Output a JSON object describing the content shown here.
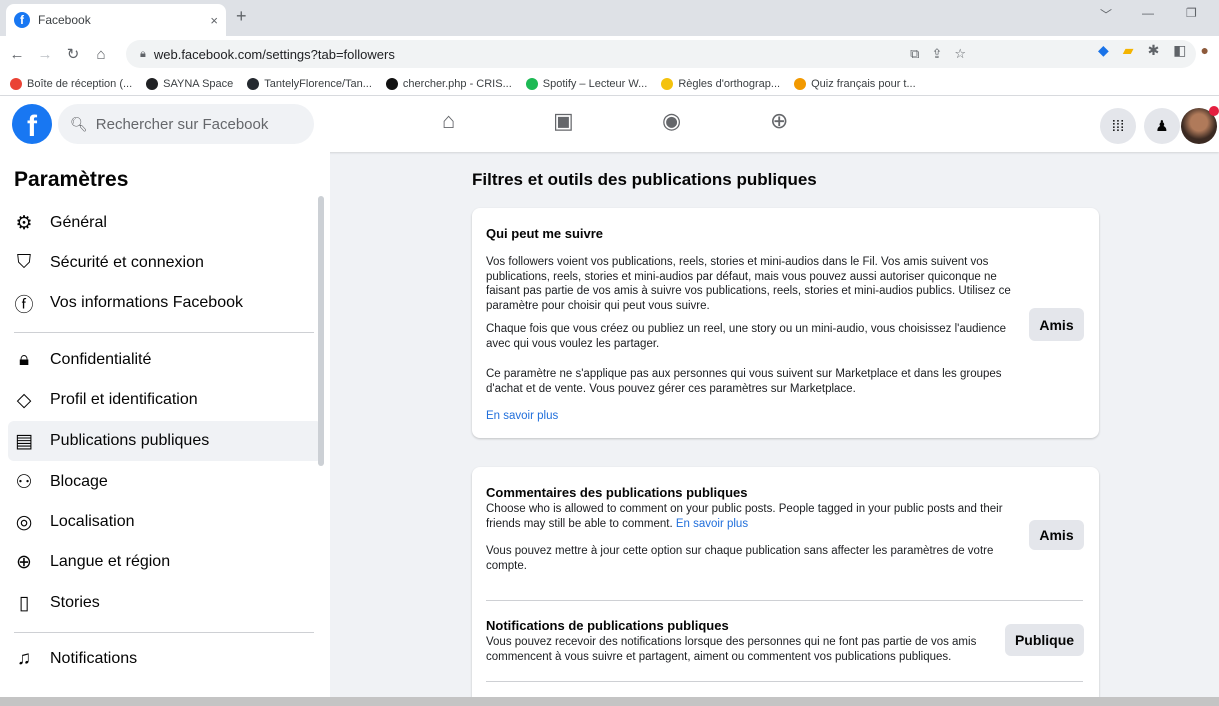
{
  "browser": {
    "tab_title": "Facebook",
    "tab_close": "×",
    "new_tab": "+",
    "url": "web.facebook.com/settings?tab=followers",
    "bookmarks": [
      {
        "label": "Boîte de réception (...",
        "color": "#ea4335"
      },
      {
        "label": "SAYNA Space",
        "color": "#202124"
      },
      {
        "label": "TantelyFlorence/Tan...",
        "color": "#24292f"
      },
      {
        "label": "chercher.php - CRIS...",
        "color": "#111111"
      },
      {
        "label": "Spotify – Lecteur W...",
        "color": "#1db954"
      },
      {
        "label": "Règles d'orthograp...",
        "color": "#f4c20d"
      },
      {
        "label": "Quiz français pour t...",
        "color": "#f29900"
      }
    ]
  },
  "header": {
    "logo": "f",
    "search_placeholder": "Rechercher sur Facebook"
  },
  "sidebar": {
    "title": "Paramètres",
    "items": [
      {
        "label": "Général",
        "icon": "gear-icon",
        "glyph": "⚙"
      },
      {
        "label": "Sécurité et connexion",
        "icon": "shield-icon",
        "glyph": "⛉"
      },
      {
        "label": "Vos informations Facebook",
        "icon": "facebook-icon",
        "glyph": "ⓕ"
      },
      {
        "label": "Confidentialité",
        "icon": "lock-icon",
        "glyph": "🔒︎"
      },
      {
        "label": "Profil et identification",
        "icon": "tag-icon",
        "glyph": "◇"
      },
      {
        "label": "Publications publiques",
        "icon": "public-posts-icon",
        "glyph": "▤"
      },
      {
        "label": "Blocage",
        "icon": "block-icon",
        "glyph": "⚇"
      },
      {
        "label": "Localisation",
        "icon": "location-icon",
        "glyph": "◎"
      },
      {
        "label": "Langue et région",
        "icon": "globe-icon",
        "glyph": "⊕"
      },
      {
        "label": "Stories",
        "icon": "book-icon",
        "glyph": "▯"
      },
      {
        "label": "Notifications",
        "icon": "bell-icon",
        "glyph": "♫"
      }
    ]
  },
  "main": {
    "title": "Filtres et outils des publications publiques",
    "follow": {
      "title": "Qui peut me suivre",
      "p1": "Vos followers voient vos publications, reels, stories et mini-audios dans le Fil. Vos amis suivent vos publications, reels, stories et mini-audios par défaut, mais vous pouvez aussi autoriser quiconque ne faisant pas partie de vos amis à suivre vos publications, reels, stories et mini-audios publics. Utilisez ce paramètre pour choisir qui peut vous suivre.",
      "p2": "Chaque fois que vous créez ou publiez un reel, une story ou un mini-audio, vous choisissez l'audience avec qui vous voulez les partager.",
      "p3": "Ce paramètre ne s'applique pas aux personnes qui vous suivent sur Marketplace et dans les groupes d'achat et de vente. Vous pouvez gérer ces paramètres sur Marketplace.",
      "link": "En savoir plus",
      "button": "Amis"
    },
    "comments": {
      "title": "Commentaires des publications publiques",
      "p1": "Choose who is allowed to comment on your public posts. People tagged in your public posts and their friends may still be able to comment.",
      "link": "En savoir plus",
      "p2": "Vous pouvez mettre à jour cette option sur chaque publication sans affecter les paramètres de votre compte.",
      "button": "Amis"
    },
    "notifications": {
      "title": "Notifications de publications publiques",
      "p1": "Vous pouvez recevoir des notifications lorsque des personnes qui ne font pas partie de vos amis commencent à vous suivre et partagent, aiment ou commentent vos publications publiques.",
      "button": "Publique"
    }
  }
}
